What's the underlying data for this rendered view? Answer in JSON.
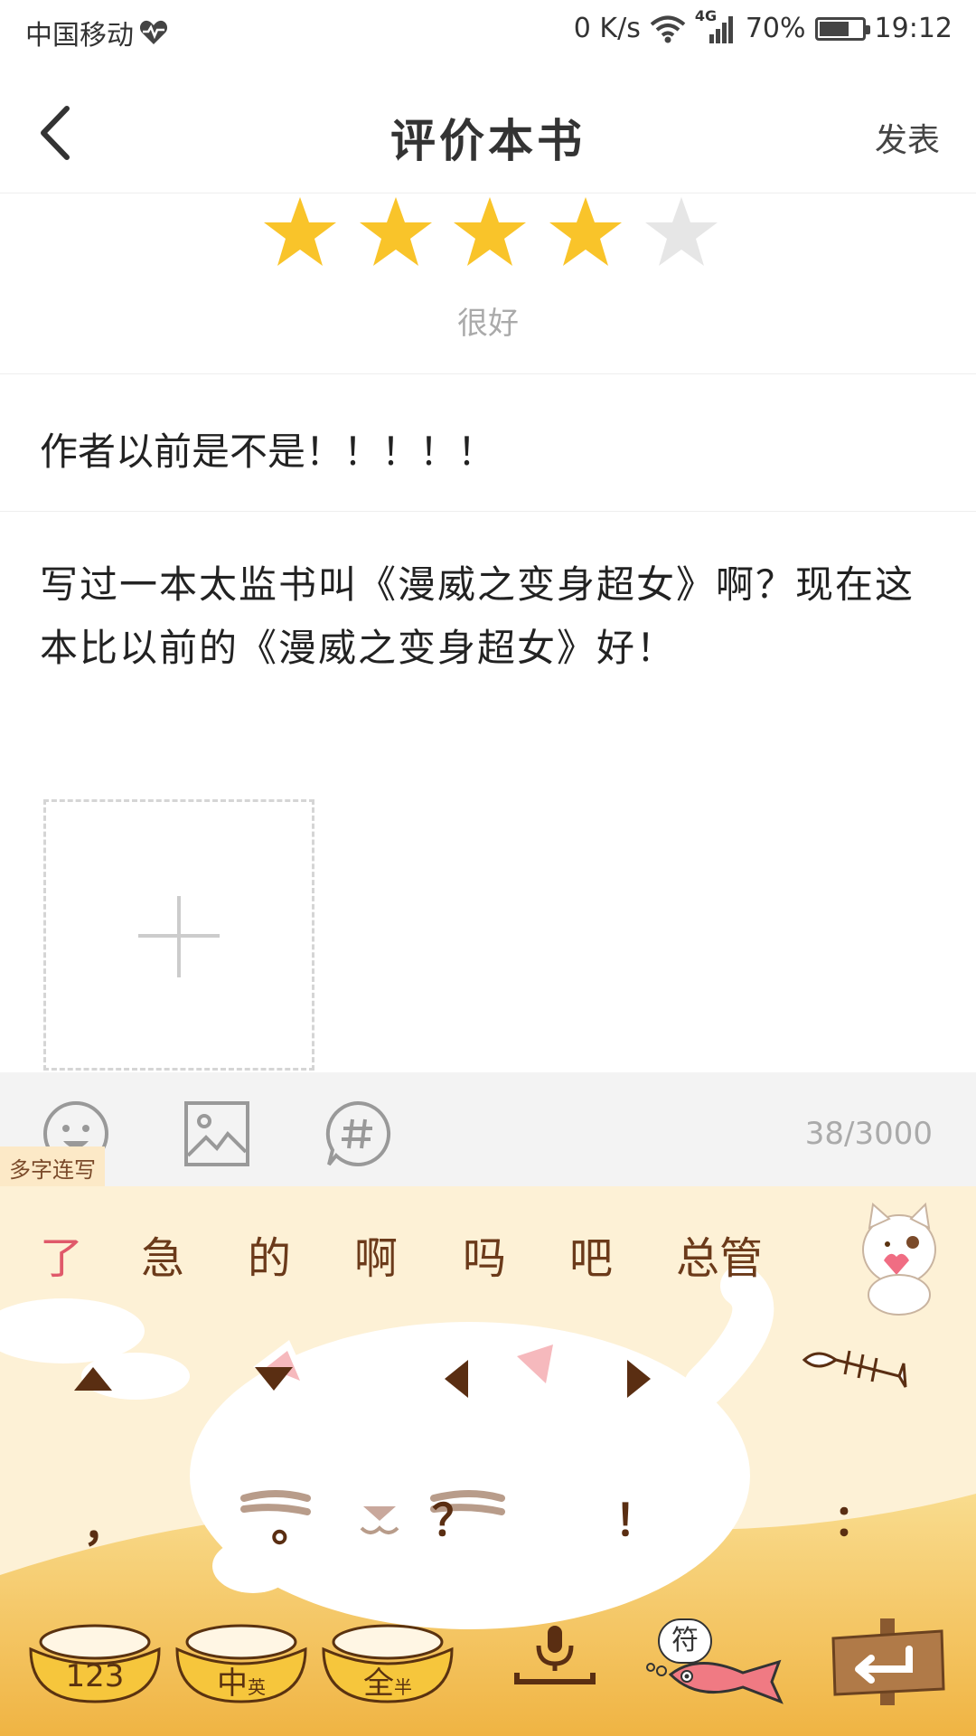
{
  "status_bar": {
    "carrier": "中国移动",
    "net_speed": "0 K/s",
    "network": "4G",
    "battery": "70%",
    "battery_level": 0.7,
    "time": "19:12"
  },
  "header": {
    "title": "评价本书",
    "publish_label": "发表"
  },
  "rating": {
    "value": 4,
    "max": 5,
    "label": "很好",
    "active_color": "#f9c42a",
    "inactive_color": "#e6e6e6"
  },
  "review": {
    "title": "作者以前是不是！！！！！",
    "body": "写过一本太监书叫《漫威之变身超女》啊？现在这本比以前的《漫威之变身超女》好！"
  },
  "toolbar": {
    "char_count": "38/3000",
    "multi_char_tag": "多字连写"
  },
  "keyboard": {
    "candidates": [
      "了",
      "急",
      "的",
      "啊",
      "吗",
      "吧",
      "总管"
    ],
    "punctuation": [
      "，",
      "。",
      "？",
      "！",
      "："
    ],
    "keys": {
      "num": "123",
      "lang_main": "中",
      "lang_sub": "英",
      "width_main": "全",
      "width_sub": "半",
      "symbols": "符"
    }
  }
}
